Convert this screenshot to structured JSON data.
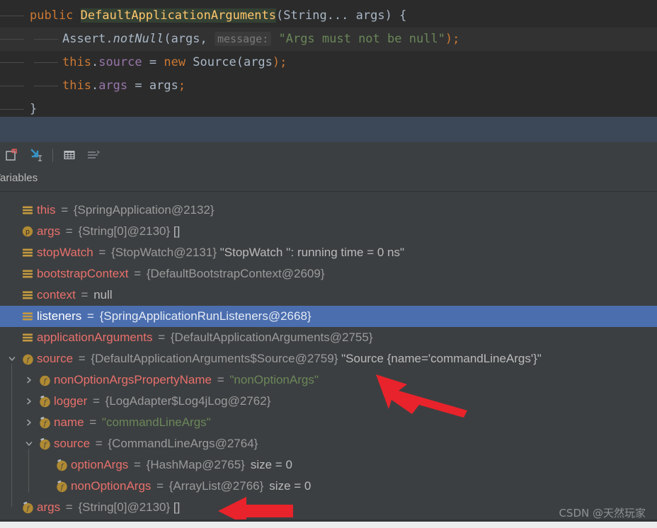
{
  "window": {
    "theme_bg": "#3C3F41",
    "editor_bg": "#2B2B2B",
    "accent_selection": "#4B6EAF",
    "arrow_color": "#E8232B"
  },
  "editor": {
    "lines": [
      {
        "id": "line-constructor-signature",
        "tokens": [
          {
            "t": "public",
            "c": "kw"
          },
          {
            "t": " ",
            "c": "sp"
          },
          {
            "t": "DefaultApplicationArguments",
            "c": "hl"
          },
          {
            "t": "(",
            "c": "punct"
          },
          {
            "t": "String",
            "c": "type"
          },
          {
            "t": "...",
            "c": "punct"
          },
          {
            "t": " args",
            "c": "type"
          },
          {
            "t": ")",
            "c": "punct"
          },
          {
            "t": " {",
            "c": "punct"
          }
        ]
      },
      {
        "id": "line-assert-notnull",
        "tokens": [
          {
            "t": "Assert",
            "c": "type"
          },
          {
            "t": ".",
            "c": "punct"
          },
          {
            "t": "notNull",
            "c": "static"
          },
          {
            "t": "(args, ",
            "c": "punct"
          },
          {
            "t": "message:",
            "c": "hint"
          },
          {
            "t": " ",
            "c": "sp"
          },
          {
            "t": "\"Args must not be null\"",
            "c": "str"
          },
          {
            "t": ");",
            "c": "semi"
          }
        ]
      },
      {
        "id": "line-this-source",
        "tokens": [
          {
            "t": "this",
            "c": "kw"
          },
          {
            "t": ".",
            "c": "punct"
          },
          {
            "t": "source",
            "c": "field"
          },
          {
            "t": " = ",
            "c": "punct"
          },
          {
            "t": "new",
            "c": "kw"
          },
          {
            "t": " Source",
            "c": "type"
          },
          {
            "t": "(args",
            "c": "punct"
          },
          {
            "t": ");",
            "c": "semi"
          }
        ]
      },
      {
        "id": "line-this-args",
        "tokens": [
          {
            "t": "this",
            "c": "kw"
          },
          {
            "t": ".",
            "c": "punct"
          },
          {
            "t": "args",
            "c": "field"
          },
          {
            "t": " = args",
            "c": "punct"
          },
          {
            "t": ";",
            "c": "semi"
          }
        ]
      },
      {
        "id": "line-closing-brace",
        "tokens": [
          {
            "t": "}",
            "c": "punct"
          }
        ]
      }
    ]
  },
  "toolbar": {
    "buttons": [
      {
        "name": "evaluate-expression-icon",
        "label": "Evaluate Expression"
      },
      {
        "name": "jump-to-source-icon",
        "label": "Jump To Source"
      },
      {
        "name": "view-as-table-icon",
        "label": "View as Table"
      },
      {
        "name": "sort-values-icon",
        "label": "Sort values alphabetically"
      }
    ]
  },
  "panel": {
    "tab_label": "Variables"
  },
  "variables": [
    {
      "id": "row-this",
      "depth": 0,
      "icon": "field-group-icon",
      "chevron": "none",
      "name": "this",
      "eq": "=",
      "ref": "{SpringApplication@2132}",
      "value": "",
      "value_kind": "none",
      "size": "",
      "selected": false
    },
    {
      "id": "row-args-param",
      "depth": 0,
      "icon": "parameter-icon",
      "chevron": "none",
      "name": "args",
      "eq": "=",
      "ref": "{String[0]@2130}",
      "value": "[]",
      "value_kind": "text",
      "size": "",
      "selected": false
    },
    {
      "id": "row-stopwatch",
      "depth": 0,
      "icon": "field-group-icon",
      "chevron": "none",
      "name": "stopWatch",
      "eq": "=",
      "ref": "{StopWatch@2131}",
      "value": "\"StopWatch '': running time = 0 ns\"",
      "value_kind": "text",
      "size": "",
      "selected": false
    },
    {
      "id": "row-bootstrapcontext",
      "depth": 0,
      "icon": "field-group-icon",
      "chevron": "none",
      "name": "bootstrapContext",
      "eq": "=",
      "ref": "{DefaultBootstrapContext@2609}",
      "value": "",
      "value_kind": "none",
      "size": "",
      "selected": false
    },
    {
      "id": "row-context",
      "depth": 0,
      "icon": "field-group-icon",
      "chevron": "none",
      "name": "context",
      "eq": "=",
      "ref": "",
      "value": "null",
      "value_kind": "null",
      "size": "",
      "selected": false
    },
    {
      "id": "row-listeners",
      "depth": 0,
      "icon": "field-group-icon",
      "chevron": "none",
      "name": "listeners",
      "eq": "=",
      "ref": "{SpringApplicationRunListeners@2668}",
      "value": "",
      "value_kind": "none",
      "size": "",
      "selected": true
    },
    {
      "id": "row-applicationarguments",
      "depth": 0,
      "icon": "field-group-icon",
      "chevron": "none",
      "name": "applicationArguments",
      "eq": "=",
      "ref": "{DefaultApplicationArguments@2755}",
      "value": "",
      "value_kind": "none",
      "size": "",
      "selected": false
    },
    {
      "id": "row-source",
      "depth": 0,
      "icon": "field-icon",
      "chevron": "expanded",
      "name": "source",
      "eq": "=",
      "ref": "{DefaultApplicationArguments$Source@2759}",
      "value": "\"Source {name='commandLineArgs'}\"",
      "value_kind": "text",
      "size": "",
      "selected": false
    },
    {
      "id": "row-nonoptionargspropertyname",
      "depth": 1,
      "icon": "field-icon",
      "chevron": "collapsed",
      "name": "nonOptionArgsPropertyName",
      "eq": "=",
      "ref": "",
      "value": "\"nonOptionArgs\"",
      "value_kind": "string",
      "size": "",
      "selected": false
    },
    {
      "id": "row-logger",
      "depth": 1,
      "icon": "field-final-icon",
      "chevron": "collapsed",
      "name": "logger",
      "eq": "=",
      "ref": "{LogAdapter$Log4jLog@2762}",
      "value": "",
      "value_kind": "none",
      "size": "",
      "selected": false
    },
    {
      "id": "row-name",
      "depth": 1,
      "icon": "field-final-icon",
      "chevron": "collapsed",
      "name": "name",
      "eq": "=",
      "ref": "",
      "value": "\"commandLineArgs\"",
      "value_kind": "string",
      "size": "",
      "selected": false
    },
    {
      "id": "row-source-inner",
      "depth": 1,
      "icon": "field-final-icon",
      "chevron": "expanded",
      "name": "source",
      "eq": "=",
      "ref": "{CommandLineArgs@2764}",
      "value": "",
      "value_kind": "none",
      "size": "",
      "selected": false
    },
    {
      "id": "row-optionargs",
      "depth": 2,
      "icon": "field-final-icon",
      "chevron": "none",
      "name": "optionArgs",
      "eq": "=",
      "ref": "{HashMap@2765}",
      "value": "",
      "value_kind": "none",
      "size": "size = 0",
      "selected": false
    },
    {
      "id": "row-nonoptionargs",
      "depth": 2,
      "icon": "field-final-icon",
      "chevron": "none",
      "name": "nonOptionArgs",
      "eq": "=",
      "ref": "{ArrayList@2766}",
      "value": "",
      "value_kind": "none",
      "size": "size = 0",
      "selected": false
    },
    {
      "id": "row-args-field",
      "depth": 0,
      "icon": "field-final-icon",
      "chevron": "none",
      "name": "args",
      "eq": "=",
      "ref": "{String[0]@2130}",
      "value": "[]",
      "value_kind": "text",
      "size": "",
      "selected": false
    }
  ],
  "annotations": [
    {
      "id": "arrow-to-source-value",
      "name": "red-arrow-annotation-1"
    },
    {
      "id": "arrow-to-args-value",
      "name": "red-arrow-annotation-2"
    }
  ],
  "watermark": {
    "text": "CSDN @天然玩家"
  }
}
